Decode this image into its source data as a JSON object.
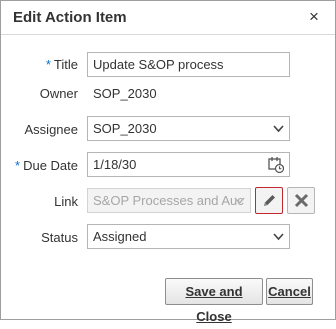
{
  "dialog": {
    "title": "Edit Action Item",
    "close_label": "×"
  },
  "form": {
    "required_marker": "*",
    "title": {
      "label": "Title",
      "value": "Update S&OP process"
    },
    "owner": {
      "label": "Owner",
      "value": "SOP_2030"
    },
    "assignee": {
      "label": "Assignee",
      "value": "SOP_2030"
    },
    "due_date": {
      "label": "Due Date",
      "value": "1/18/30"
    },
    "link": {
      "label": "Link",
      "value": "S&OP Processes and Auc"
    },
    "status": {
      "label": "Status",
      "value": "Assigned"
    }
  },
  "icons": {
    "dropdown": "chevron-down-icon",
    "calendar": "calendar-icon",
    "edit": "pencil-icon",
    "remove": "close-x-icon"
  },
  "buttons": {
    "save": "Save and Close",
    "cancel": "Cancel"
  },
  "colors": {
    "required": "#0572ce",
    "focus_border": "#c4262e"
  }
}
